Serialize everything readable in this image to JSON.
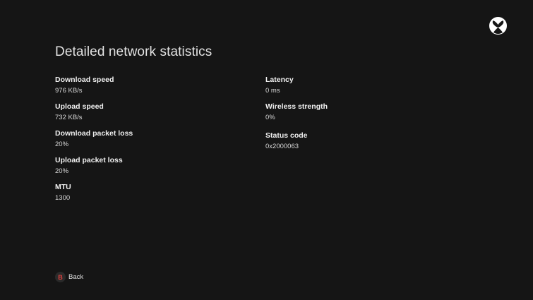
{
  "page": {
    "title": "Detailed network statistics"
  },
  "stats_left": [
    {
      "label": "Download speed",
      "value": "976 KB/s"
    },
    {
      "label": "Upload speed",
      "value": "732 KB/s"
    },
    {
      "label": "Download packet loss",
      "value": "20%"
    },
    {
      "label": "Upload packet loss",
      "value": "20%"
    },
    {
      "label": "MTU",
      "value": "1300"
    }
  ],
  "stats_right": [
    {
      "label": "Latency",
      "value": "0 ms"
    },
    {
      "label": "Wireless strength",
      "value": "0%"
    },
    {
      "label": "Status code",
      "value": "0x2000063"
    }
  ],
  "footer": {
    "back_glyph": "B",
    "back_label": "Back"
  },
  "colors": {
    "background": "#151515",
    "b_button": "#e0413f"
  },
  "icons": {
    "logo": "xbox-logo-icon"
  }
}
